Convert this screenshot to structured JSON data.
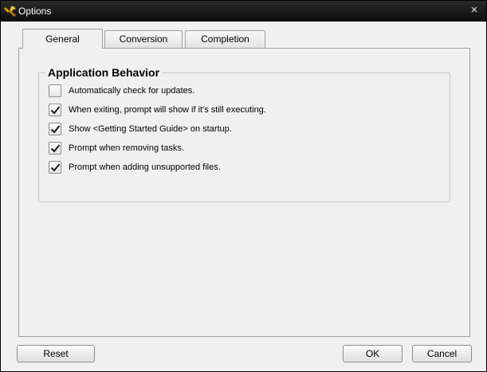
{
  "window": {
    "title": "Options",
    "app_icon": "tools-wrench-icon",
    "close_glyph": "×"
  },
  "tabs": [
    {
      "label": "General",
      "active": true
    },
    {
      "label": "Conversion",
      "active": false
    },
    {
      "label": "Completion",
      "active": false
    }
  ],
  "group": {
    "title": "Application Behavior",
    "options": [
      {
        "label": "Automatically check for updates.",
        "checked": false
      },
      {
        "label": "When exiting, prompt will show if it's still executing.",
        "checked": true
      },
      {
        "label": "Show <Getting Started Guide> on startup.",
        "checked": true
      },
      {
        "label": "Prompt when removing tasks.",
        "checked": true
      },
      {
        "label": "Prompt when adding unsupported files.",
        "checked": true
      }
    ]
  },
  "buttons": {
    "reset": "Reset",
    "ok": "OK",
    "cancel": "Cancel"
  },
  "colors": {
    "titlebar": "#121212",
    "background": "#f0f0f0",
    "border": "#a0a0a0"
  }
}
